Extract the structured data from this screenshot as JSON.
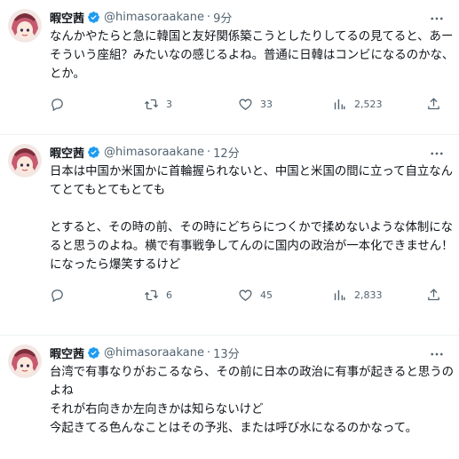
{
  "tweets": [
    {
      "display_name": "暇空茜",
      "handle": "@himasoraakane",
      "separator": "·",
      "time": "9分",
      "lines": [
        "なんかやたらと急に韓国と友好関係築こうとしたりしてるの見てると、あー",
        "そういう座組？みたいなの感じるよね。普通に日韓はコンビになるのかな、",
        "とか。"
      ],
      "reply_count": "",
      "retweet_count": "3",
      "like_count": "33",
      "view_count": "2,523"
    },
    {
      "display_name": "暇空茜",
      "handle": "@himasoraakane",
      "separator": "·",
      "time": "12分",
      "lines": [
        "日本は中国か米国かに首輪握られないと、中国と米国の間に立って自立なん",
        "てとてもとてもとても",
        "",
        "とすると、その時の前、その時にどちらにつくかで揉めないような体制にな",
        "ると思うのよね。横で有事戦争してんのに国内の政治が一本化できません！",
        "になったら爆笑するけど"
      ],
      "reply_count": "",
      "retweet_count": "6",
      "like_count": "45",
      "view_count": "2,833"
    },
    {
      "display_name": "暇空茜",
      "handle": "@himasoraakane",
      "separator": "·",
      "time": "13分",
      "lines": [
        "台湾で有事なりがおこるなら、その前に日本の政治に有事が起きると思うの",
        "よね",
        "それが右向きか左向きかは知らないけど",
        "今起きてる色んなことはその予兆、または呼び水になるのかなって。"
      ]
    }
  ],
  "icons": {
    "verified": "verified-badge-icon",
    "more": "more-dots-icon",
    "reply": "reply-icon",
    "retweet": "retweet-icon",
    "like": "heart-icon",
    "views": "views-chart-icon",
    "share": "share-icon"
  },
  "colors": {
    "text": "#0f1419",
    "muted": "#536471",
    "verified": "#1d9bf0",
    "divider": "#eff3f4"
  }
}
